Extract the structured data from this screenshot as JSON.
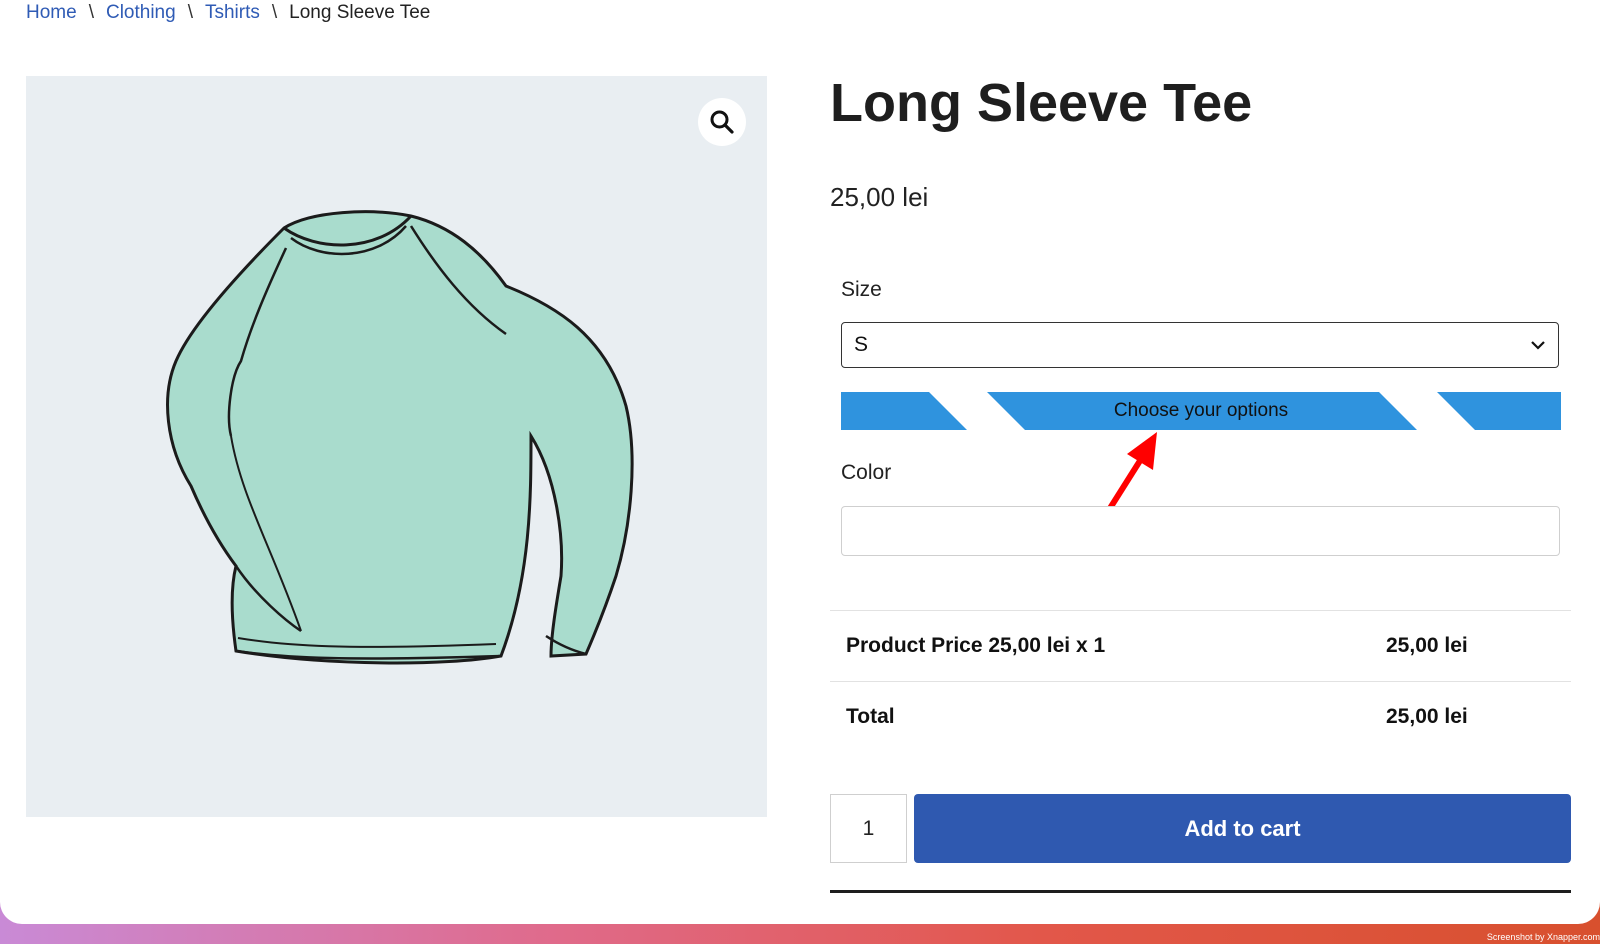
{
  "breadcrumb": {
    "home": "Home",
    "category": "Clothing",
    "subcategory": "Tshirts",
    "current": "Long Sleeve Tee",
    "separator": "\\"
  },
  "product": {
    "title": "Long Sleeve Tee",
    "price": "25,00 lei",
    "image_icon": "long-sleeve-tee-illustration",
    "zoom_icon": "search-icon"
  },
  "options": {
    "size_label": "Size",
    "size_value": "S",
    "notice_text": "Choose your options",
    "color_label": "Color",
    "color_value": ""
  },
  "summary": {
    "rows": [
      {
        "label": "Product Price 25,00 lei x 1",
        "value": "25,00 lei"
      },
      {
        "label": "Total",
        "value": "25,00 lei"
      }
    ]
  },
  "cart": {
    "quantity": "1",
    "add_label": "Add to cart"
  },
  "colors": {
    "link": "#2f5bb5",
    "notice_bar": "#2f93de",
    "button": "#2f59b0",
    "arrow": "#ff0000",
    "shirt_fill": "#a9dccd"
  },
  "watermark": "Screenshot by Xnapper.com"
}
